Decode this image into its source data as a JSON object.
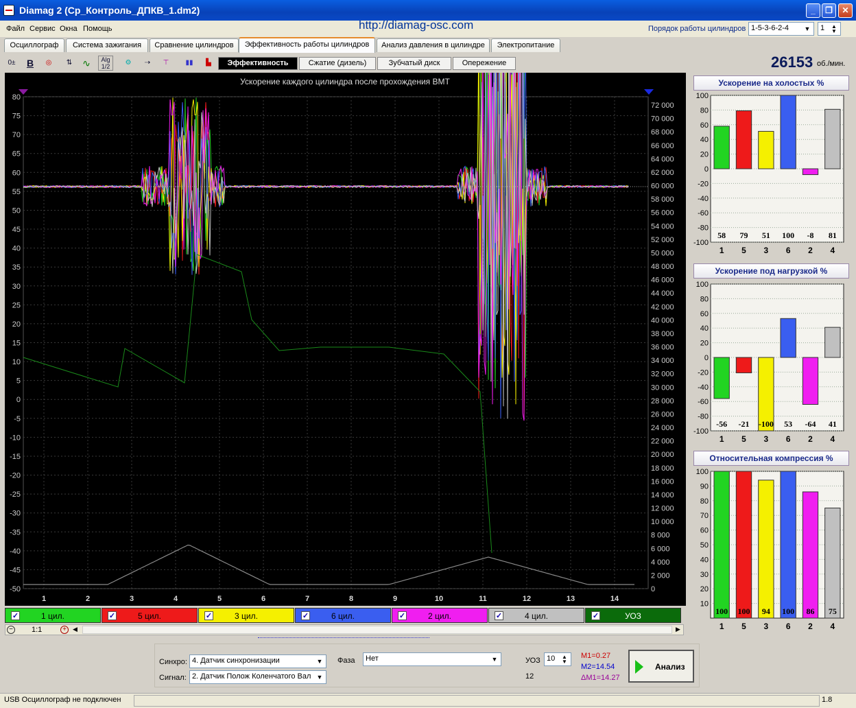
{
  "window": {
    "title": "Diamag 2 (Ср_Контроль_ДПКВ_1.dm2)",
    "url": "http://diamag-osc.com"
  },
  "menu": [
    "Файл",
    "Сервис",
    "Окна",
    "Помощь"
  ],
  "firing_order": {
    "label": "Порядок работы цилиндров",
    "value": "1-5-3-6-2-4",
    "spin_value": "1"
  },
  "tabs": [
    "Осциллограф",
    "Система зажигания",
    "Сравнение цилиндров",
    "Эффективность работы цилиндров",
    "Анализ давления в цилиндре",
    "Электропитание"
  ],
  "toolbar": {
    "subtabs": [
      "Эффективность",
      "Сжатие (дизель)",
      "Зубчатый диск",
      "Опережение"
    ],
    "rpm": "26153",
    "rpm_unit": "об./мин."
  },
  "plot": {
    "title": "Ускорение каждого цилиндра после прохождения ВМТ",
    "y_left": [
      "80",
      "75",
      "70",
      "65",
      "60",
      "55",
      "50",
      "45",
      "40",
      "35",
      "30",
      "25",
      "20",
      "15",
      "10",
      "5",
      "0",
      "-5",
      "-10",
      "-15",
      "-20",
      "-25",
      "-30",
      "-35",
      "-40",
      "-45",
      "-50"
    ],
    "y_right": [
      "72 000",
      "70 000",
      "68 000",
      "66 000",
      "64 000",
      "62 000",
      "60 000",
      "58 000",
      "56 000",
      "54 000",
      "52 000",
      "50 000",
      "48 000",
      "46 000",
      "44 000",
      "42 000",
      "40 000",
      "38 000",
      "36 000",
      "34 000",
      "32 000",
      "30 000",
      "28 000",
      "26 000",
      "24 000",
      "22 000",
      "20 000",
      "18 000",
      "16 000",
      "14 000",
      "12 000",
      "10 000",
      "8 000",
      "6 000",
      "4 000",
      "2 000",
      "0"
    ],
    "x": [
      "1",
      "2",
      "3",
      "4",
      "5",
      "6",
      "7",
      "8",
      "9",
      "10",
      "11",
      "12",
      "13",
      "14"
    ]
  },
  "legend": [
    {
      "label": "1 цил.",
      "color": "#22d422"
    },
    {
      "label": "5 цил.",
      "color": "#ee1a1a"
    },
    {
      "label": "3 цил.",
      "color": "#f5f000"
    },
    {
      "label": "6 цил.",
      "color": "#3a5ef0"
    },
    {
      "label": "2 цил.",
      "color": "#f01ef0"
    },
    {
      "label": "4 цил.",
      "color": "#c0c0c0"
    },
    {
      "label": "УОЗ",
      "color": "#0b6b0b"
    }
  ],
  "zoom": {
    "value": "1:1"
  },
  "chart_data": [
    {
      "type": "bar",
      "title": "Ускорение на холостых %",
      "categories": [
        "1",
        "5",
        "3",
        "6",
        "2",
        "4"
      ],
      "values": [
        58,
        79,
        51,
        100,
        -8,
        81
      ],
      "ylim": [
        -100,
        100
      ],
      "y_ticks": [
        "100",
        "80",
        "60",
        "40",
        "20",
        "0",
        "-20",
        "-40",
        "-60",
        "-80",
        "-100"
      ],
      "colors": [
        "#22d422",
        "#ee1a1a",
        "#f5f000",
        "#3a5ef0",
        "#f01ef0",
        "#c0c0c0"
      ]
    },
    {
      "type": "bar",
      "title": "Ускорение под нагрузкой %",
      "categories": [
        "1",
        "5",
        "3",
        "6",
        "2",
        "4"
      ],
      "values": [
        -56,
        -21,
        -100,
        53,
        -64,
        41
      ],
      "ylim": [
        -100,
        100
      ],
      "y_ticks": [
        "100",
        "80",
        "60",
        "40",
        "20",
        "0",
        "-20",
        "-40",
        "-60",
        "-80",
        "-100"
      ],
      "colors": [
        "#22d422",
        "#ee1a1a",
        "#f5f000",
        "#3a5ef0",
        "#f01ef0",
        "#c0c0c0"
      ]
    },
    {
      "type": "bar",
      "title": "Относительная компрессия %",
      "categories": [
        "1",
        "5",
        "3",
        "6",
        "2",
        "4"
      ],
      "values": [
        100,
        100,
        94,
        100,
        86,
        75
      ],
      "ylim": [
        0,
        100
      ],
      "y_ticks": [
        "100",
        "90",
        "80",
        "70",
        "60",
        "50",
        "40",
        "30",
        "20",
        "10"
      ],
      "colors": [
        "#22d422",
        "#ee1a1a",
        "#f5f000",
        "#3a5ef0",
        "#f01ef0",
        "#c0c0c0"
      ]
    }
  ],
  "bottom": {
    "sync_label": "Синхро:",
    "sync_value": "4. Датчик синхронизации",
    "signal_label": "Сигнал:",
    "signal_value": "2. Датчик Полож Коленчатого Вал",
    "phase_label": "Фаза",
    "phase_value": "Нет",
    "uoz_label": "УОЗ",
    "uoz_value": "10",
    "uoz_sub": "12",
    "m1": "M1=0.27",
    "m2": "M2=14.54",
    "dm": "ΔM1=14.27",
    "analysis_label": "Анализ"
  },
  "status": {
    "left": "USB Осциллограф не подключен",
    "right": "1.8"
  }
}
